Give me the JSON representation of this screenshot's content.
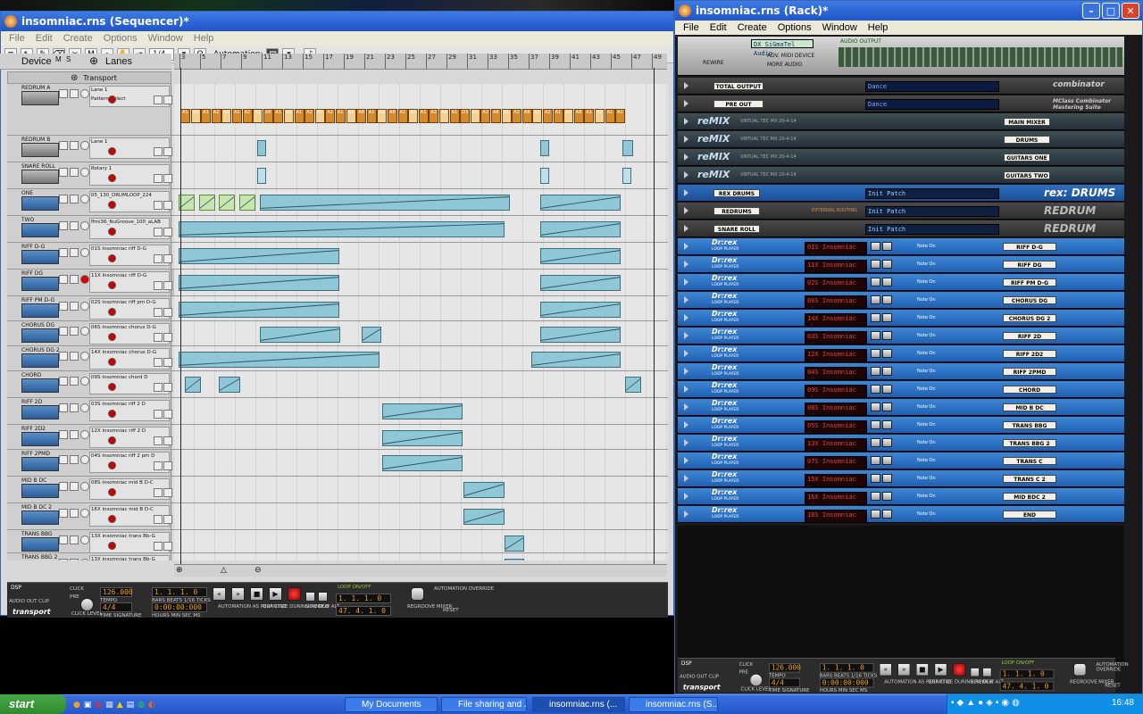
{
  "sequencer": {
    "title": "insomniac.rns (Sequencer)*",
    "menu": [
      "File",
      "Edit",
      "Create",
      "Options",
      "Window",
      "Help"
    ],
    "quantize": "1/4",
    "automation_label": "Automation:",
    "device_label": "Device",
    "lanes_label": "Lanes",
    "transport_track": "Transport",
    "ruler": [
      "3",
      "5",
      "7",
      "9",
      "11",
      "13",
      "15",
      "17",
      "19",
      "21",
      "23",
      "25",
      "27",
      "29",
      "31",
      "33",
      "35",
      "37",
      "39",
      "41",
      "43",
      "45",
      "47",
      "49"
    ],
    "tracks": [
      {
        "name": "REDRUM A",
        "lane": "Lane 1",
        "lane2": "Pattern Select",
        "kind": "redrum"
      },
      {
        "name": "REDRUM B",
        "lane": "Lane 1",
        "kind": "redrum"
      },
      {
        "name": "SNARE ROLL",
        "lane": "Rotary 1",
        "kind": "redrum"
      },
      {
        "name": "ONE",
        "lane": "05_130_DRUMLOOP_224",
        "kind": "rex"
      },
      {
        "name": "TWO",
        "lane": "ffmi36_NuGroove_100_aLAB",
        "kind": "rex"
      },
      {
        "name": "RIFF D-G",
        "lane": "01S insomniac riff D-G",
        "kind": "rex"
      },
      {
        "name": "RIFF DG",
        "lane": "11X insomniac riff D-G",
        "kind": "rex"
      },
      {
        "name": "RIFF PM D-G",
        "lane": "02S insomniac riff pm D-G",
        "kind": "rex"
      },
      {
        "name": "CHORUS DG",
        "lane": "06S insomniac chorus D-G",
        "kind": "rex"
      },
      {
        "name": "CHORUS DG 2",
        "lane": "14X insomniac chorus D-G",
        "kind": "rex"
      },
      {
        "name": "CHORD",
        "lane": "09S insomniac chord D",
        "kind": "rex"
      },
      {
        "name": "RIFF 2D",
        "lane": "03S insomniac riff 2 D",
        "kind": "rex"
      },
      {
        "name": "RIFF 2D2",
        "lane": "12X insomniac riff 2 D",
        "kind": "rex"
      },
      {
        "name": "RIFF 2PMD",
        "lane": "04S insomniac riff 2 pm D",
        "kind": "rex"
      },
      {
        "name": "MID B DC",
        "lane": "08S insomniac mid B D-C",
        "kind": "rex"
      },
      {
        "name": "MID B DC 2",
        "lane": "16X insomniac mid B D-C",
        "kind": "rex"
      },
      {
        "name": "TRANS BBG",
        "lane": "13X insomniac trans Bb-G",
        "kind": "rex"
      },
      {
        "name": "TRANS BBG 2",
        "lane": "13X insomniac trans Bb-G",
        "kind": "rex"
      }
    ],
    "pattern_labels": [
      "A1",
      "D3",
      "A1",
      "A2",
      "A1",
      "A1",
      "A2",
      "A1",
      "A8",
      "A1",
      "A2",
      "A1",
      "A2",
      "A1",
      "A2",
      "A1",
      "A2",
      "A8",
      "A1",
      "A2",
      "A8",
      "A1",
      "A2",
      "A1",
      "A2",
      "A8",
      "A1",
      "D3",
      "A1",
      "A2",
      "A8",
      "A1",
      "A2",
      "A8",
      "A1",
      "A2",
      "A1",
      "A2",
      "A8",
      "A1",
      "A2",
      "A1",
      "A2"
    ]
  },
  "transport": {
    "tempo": "126.000",
    "position": "1. 1. 1. 0",
    "time": "0:00:00:000",
    "signature": "4/4",
    "loop_left": "1. 1. 1. 0",
    "loop_right": "47. 4. 1. 0",
    "tempo_label": "TEMPO",
    "sig_label": "TIME SIGNATURE",
    "bars_label": "BARS BEATS 1/16 TICKS",
    "hms_label": "HOURS MIN SEC MS",
    "click": "CLICK",
    "pre": "PRE",
    "click_level": "CLICK LEVEL",
    "dsp": "DSP",
    "audio_out": "AUDIO OUT CLIP",
    "loop_onoff": "LOOP ON/OFF",
    "quant_rec": "QUANTIZE DURING REC",
    "auto_rec": "AUTOMATION AS PERF CTRL",
    "new_dub": "NEW DUB",
    "new_alt": "NEW ALT",
    "reg_mixer": "REGROOVE MIXER",
    "auto_override": "AUTOMATION OVERRIDE",
    "reset": "RESET",
    "brand": "transport"
  },
  "rack": {
    "title": "insomniac.rns (Rack)*",
    "menu": [
      "File",
      "Edit",
      "Create",
      "Options",
      "Window",
      "Help"
    ],
    "hw": {
      "card": "DX SiGmaTel Audio",
      "audio_output": "AUDIO OUTPUT",
      "adv": "ADV. MIDI DEVICE",
      "more": "MORE AUDIO",
      "in_use": "IN USE",
      "rewire": "REWIRE"
    },
    "combinators": [
      {
        "tape": "TOTAL OUTPUT",
        "patch": "Dance",
        "brand": "combinator"
      },
      {
        "tape": "PRE OUT",
        "patch": "Dance",
        "brand": "MClass Combinator Mastering Suite"
      }
    ],
    "remix": [
      {
        "tape": "MAIN MIXER",
        "model": "VIRTUAL TEC MX 20-4-14"
      },
      {
        "tape": "DRUMS",
        "model": "VIRTUAL TEC MX 20-4-14"
      },
      {
        "tape": "GUITARS ONE",
        "model": "VIRTUAL TEC MX 20-4-14"
      },
      {
        "tape": "GUITARS TWO",
        "model": "VIRTUAL TEC MX 20-4-14"
      }
    ],
    "remix_brand": "reMIX",
    "drum_units": [
      {
        "tape": "REX DRUMS",
        "patch": "Init Patch",
        "brand": "rex: DRUMS"
      },
      {
        "tape": "REDRUMS",
        "patch": "Init Patch",
        "brand": "REDRUM",
        "routing": "EXTERNAL ROUTING"
      },
      {
        "tape": "SNARE ROLL",
        "patch": "Init Patch",
        "brand": "REDRUM"
      }
    ],
    "dr_rex": [
      {
        "file": "01S Insomniac ri",
        "tape": "RIFF D-G"
      },
      {
        "file": "11X Insomniac ri",
        "tape": "RIFF DG"
      },
      {
        "file": "02S Insomniac ri",
        "tape": "RIFF PM D-G"
      },
      {
        "file": "06S Insomniac ch",
        "tape": "CHORUS DG"
      },
      {
        "file": "14X Insomniac ch",
        "tape": "CHORUS DG 2"
      },
      {
        "file": "03S Insomniac ri",
        "tape": "RIFF 2D"
      },
      {
        "file": "12X Insomniac ri",
        "tape": "RIFF 2D2"
      },
      {
        "file": "04S Insomniac ri",
        "tape": "RIFF 2PMD"
      },
      {
        "file": "09S Insomniac ch",
        "tape": "CHORD"
      },
      {
        "file": "08S Insomniac mi",
        "tape": "MID B DC"
      },
      {
        "file": "05S Insomniac tr",
        "tape": "TRANS BBG"
      },
      {
        "file": "13X Insomniac tr",
        "tape": "TRANS BBG 2"
      },
      {
        "file": "07S Insomniac tr",
        "tape": "TRANS C"
      },
      {
        "file": "15X Insomniac tr",
        "tape": "TRANS C 2"
      },
      {
        "file": "16X Insomniac mi",
        "tape": "MID BDC 2"
      },
      {
        "file": "10S Insomniac en",
        "tape": "END"
      }
    ],
    "drrex_brand": "Dr:rex",
    "drrex_sub": "LOOP PLAYER",
    "note_on": "Note On"
  },
  "taskbar": {
    "start": "start",
    "items": [
      "My Documents",
      "File sharing and ...",
      "insomniac.rns (...",
      "insomniac.rns (S..."
    ],
    "clock": "16:48"
  }
}
